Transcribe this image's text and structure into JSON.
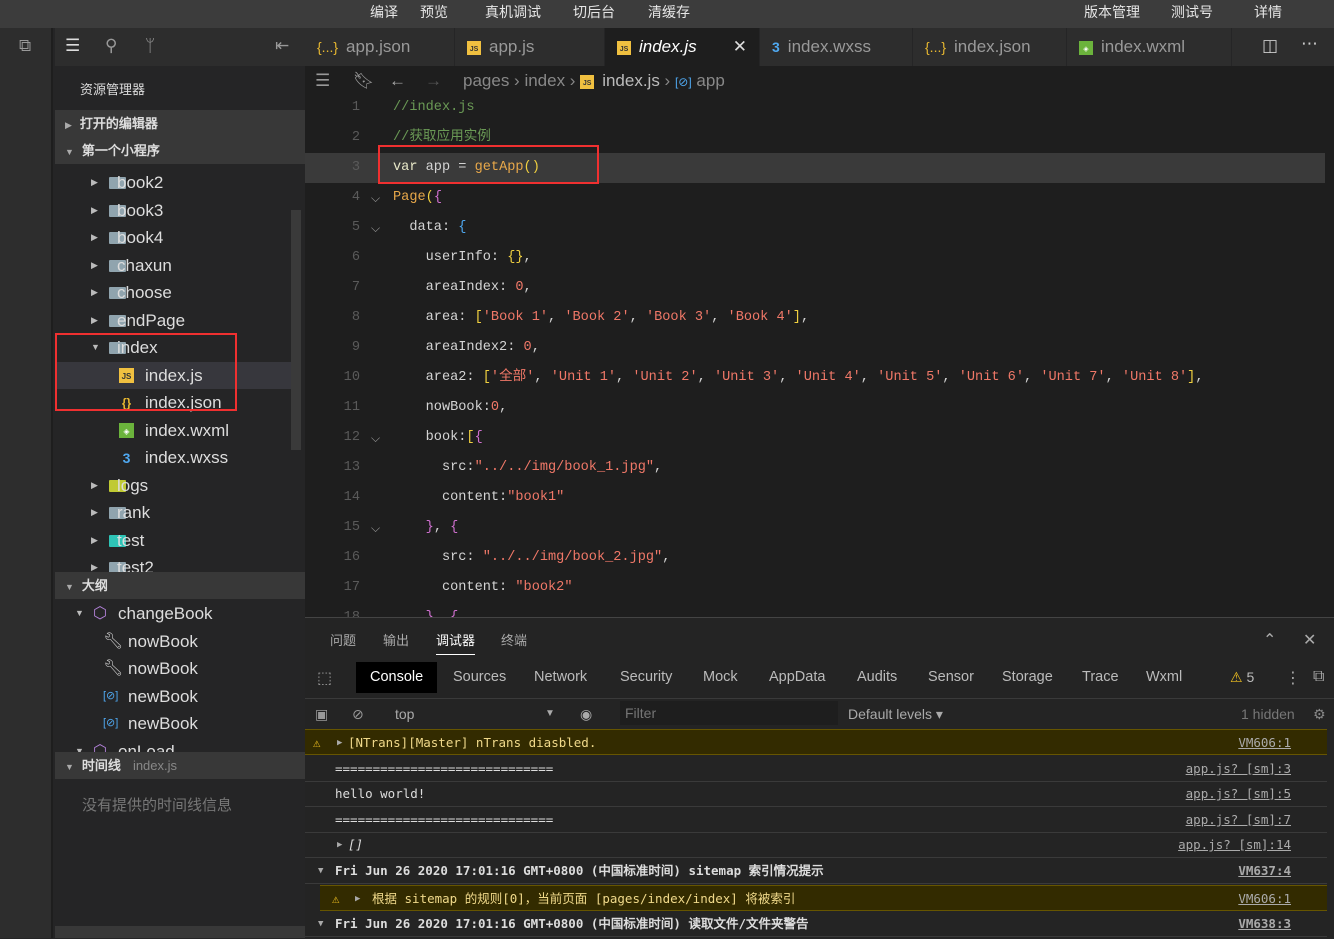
{
  "topbar": {
    "left": [
      "编译",
      "预览",
      "真机调试",
      "切后台",
      "清缓存"
    ],
    "right": [
      "版本管理",
      "测试号",
      "详情"
    ]
  },
  "sidebar": {
    "title": "资源管理器",
    "open_editors": "打开的编辑器",
    "project": "第一个小程序",
    "tree": [
      {
        "label": "book2",
        "type": "folder"
      },
      {
        "label": "book3",
        "type": "folder"
      },
      {
        "label": "book4",
        "type": "folder"
      },
      {
        "label": "chaxun",
        "type": "folder"
      },
      {
        "label": "choose",
        "type": "folder"
      },
      {
        "label": "endPage",
        "type": "folder"
      },
      {
        "label": "index",
        "type": "folder-open"
      },
      {
        "label": "index.js",
        "type": "js"
      },
      {
        "label": "index.json",
        "type": "json"
      },
      {
        "label": "index.wxml",
        "type": "wxml"
      },
      {
        "label": "index.wxss",
        "type": "wxss"
      },
      {
        "label": "logs",
        "type": "folder"
      },
      {
        "label": "rank",
        "type": "folder"
      },
      {
        "label": "test",
        "type": "folder"
      },
      {
        "label": "test2",
        "type": "folder"
      }
    ],
    "outline_title": "大纲",
    "outline": [
      {
        "label": "changeBook",
        "icon": "cube"
      },
      {
        "label": "nowBook",
        "icon": "wrench"
      },
      {
        "label": "nowBook",
        "icon": "wrench"
      },
      {
        "label": "newBook",
        "icon": "variable"
      },
      {
        "label": "newBook",
        "icon": "variable"
      },
      {
        "label": "onLoad",
        "icon": "cube"
      }
    ],
    "timeline_title": "时间线",
    "timeline_file": "index.js",
    "timeline_empty": "没有提供的时间线信息"
  },
  "tabs": [
    {
      "label": "app.json",
      "icon": "json"
    },
    {
      "label": "app.js",
      "icon": "js"
    },
    {
      "label": "index.js",
      "icon": "js",
      "active": true
    },
    {
      "label": "index.wxss",
      "icon": "wxss"
    },
    {
      "label": "index.json",
      "icon": "json"
    },
    {
      "label": "index.wxml",
      "icon": "wxml"
    }
  ],
  "breadcrumb": [
    "pages",
    "index",
    "index.js",
    "app"
  ],
  "code": [
    [
      [
        "//index.js",
        "cm"
      ]
    ],
    [
      [
        "//获取应用实例",
        "cm"
      ]
    ],
    [
      [
        "var",
        "kw"
      ],
      [
        " app = ",
        "id"
      ],
      [
        "getApp",
        "fn"
      ],
      [
        "()",
        "br"
      ]
    ],
    [
      [
        "Page",
        "fn"
      ],
      [
        "(",
        "br"
      ],
      [
        "{",
        "br2"
      ]
    ],
    [
      [
        "  data: ",
        "id"
      ],
      [
        "{",
        "br3"
      ]
    ],
    [
      [
        "    userInfo: ",
        "id"
      ],
      [
        "{}",
        "br"
      ],
      [
        ",",
        "id"
      ]
    ],
    [
      [
        "    areaIndex: ",
        "id"
      ],
      [
        "0",
        "num"
      ],
      [
        ",",
        "id"
      ]
    ],
    [
      [
        "    area: ",
        "id"
      ],
      [
        "[",
        "br"
      ],
      [
        "'Book 1'",
        "str"
      ],
      [
        ", ",
        "id"
      ],
      [
        "'Book 2'",
        "str"
      ],
      [
        ", ",
        "id"
      ],
      [
        "'Book 3'",
        "str"
      ],
      [
        ", ",
        "id"
      ],
      [
        "'Book 4'",
        "str"
      ],
      [
        "]",
        "br"
      ],
      [
        ",",
        "id"
      ]
    ],
    [
      [
        "    areaIndex2: ",
        "id"
      ],
      [
        "0",
        "num"
      ],
      [
        ",",
        "id"
      ]
    ],
    [
      [
        "    area2: ",
        "id"
      ],
      [
        "[",
        "br"
      ],
      [
        "'全部'",
        "str"
      ],
      [
        ", ",
        "id"
      ],
      [
        "'Unit 1'",
        "str"
      ],
      [
        ", ",
        "id"
      ],
      [
        "'Unit 2'",
        "str"
      ],
      [
        ", ",
        "id"
      ],
      [
        "'Unit 3'",
        "str"
      ],
      [
        ", ",
        "id"
      ],
      [
        "'Unit 4'",
        "str"
      ],
      [
        ", ",
        "id"
      ],
      [
        "'Unit 5'",
        "str"
      ],
      [
        ", ",
        "id"
      ],
      [
        "'Unit 6'",
        "str"
      ],
      [
        ", ",
        "id"
      ],
      [
        "'Unit 7'",
        "str"
      ],
      [
        ", ",
        "id"
      ],
      [
        "'Unit 8'",
        "str"
      ],
      [
        "]",
        "br"
      ],
      [
        ",",
        "id"
      ]
    ],
    [
      [
        "    nowBook:",
        "id"
      ],
      [
        "0",
        "num"
      ],
      [
        ",",
        "id"
      ]
    ],
    [
      [
        "    book:",
        "id"
      ],
      [
        "[",
        "br"
      ],
      [
        "{",
        "br2"
      ]
    ],
    [
      [
        "      src:",
        "id"
      ],
      [
        "\"../../img/book_1.jpg\"",
        "str"
      ],
      [
        ",",
        "id"
      ]
    ],
    [
      [
        "      content:",
        "id"
      ],
      [
        "\"book1\"",
        "str"
      ]
    ],
    [
      [
        "    ",
        "id"
      ],
      [
        "}",
        "br2"
      ],
      [
        ", ",
        "id"
      ],
      [
        "{",
        "br2"
      ]
    ],
    [
      [
        "      src: ",
        "id"
      ],
      [
        "\"../../img/book_2.jpg\"",
        "str"
      ],
      [
        ",",
        "id"
      ]
    ],
    [
      [
        "      content: ",
        "id"
      ],
      [
        "\"book2\"",
        "str"
      ]
    ],
    [
      [
        "    ",
        "id"
      ],
      [
        "}",
        "br2"
      ],
      [
        ", ",
        "id"
      ],
      [
        "{",
        "br2"
      ]
    ]
  ],
  "folds": [
    4,
    5,
    12,
    15,
    18
  ],
  "panel": {
    "tabs": [
      "问题",
      "输出",
      "调试器",
      "终端"
    ],
    "active_tab": "调试器",
    "devtabs": [
      "Console",
      "Sources",
      "Network",
      "Security",
      "Mock",
      "AppData",
      "Audits",
      "Sensor",
      "Storage",
      "Trace",
      "Wxml"
    ],
    "warn_count": "5",
    "context": "top",
    "filter_placeholder": "Filter",
    "levels": "Default levels",
    "hidden": "1 hidden",
    "logs": [
      {
        "text": "[NTrans][Master] nTrans diasbled.",
        "src": "VM606:1",
        "level": "warn",
        "expand": "▶"
      },
      {
        "text": "=============================",
        "src": "app.js? [sm]:3",
        "level": "log"
      },
      {
        "text": "hello world!",
        "src": "app.js? [sm]:5",
        "level": "log"
      },
      {
        "text": "=============================",
        "src": "app.js? [sm]:7",
        "level": "log"
      },
      {
        "text": "[]",
        "src": "app.js? [sm]:14",
        "level": "log",
        "expand": "▶"
      },
      {
        "text": "Fri Jun 26 2020 17:01:16 GMT+0800 (中国标准时间) sitemap 索引情况提示",
        "src": "VM637:4",
        "level": "group",
        "expand": "▼"
      },
      {
        "text": "根据 sitemap 的规则[0]，当前页面 [pages/index/index] 将被索引",
        "src": "VM606:1",
        "level": "warn",
        "expand": "▶",
        "indent": true
      },
      {
        "text": "Fri Jun 26 2020 17:01:16 GMT+0800 (中国标准时间) 读取文件/文件夹警告",
        "src": "VM638:3",
        "level": "group",
        "expand": "▼"
      }
    ]
  }
}
